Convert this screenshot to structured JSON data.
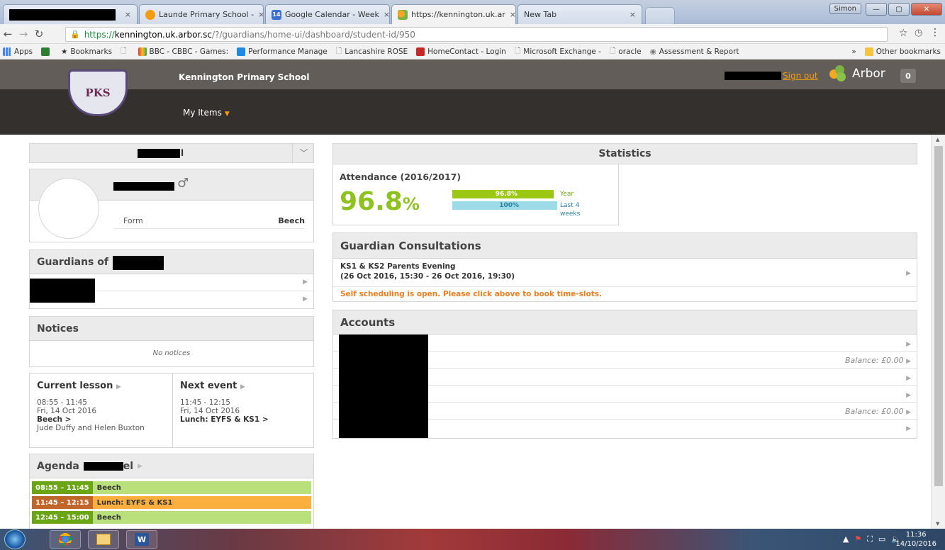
{
  "browser": {
    "tabs": [
      {
        "title": "",
        "redacted": true
      },
      {
        "title": "Launde Primary School -"
      },
      {
        "title": "Google Calendar - Week"
      },
      {
        "title": "https://kennington.uk.ar"
      },
      {
        "title": "New Tab"
      }
    ],
    "calendar_icon_text": "14",
    "user_button": "Simon",
    "url_protocol": "https://",
    "url_host": "kennington.uk.arbor.sc",
    "url_path": "/?/guardians/home-ui/dashboard/student-id/950",
    "bookmarks": [
      "Apps",
      "Bookmarks",
      "BBC - CBBC - Games:",
      "Performance Manage",
      "Lancashire ROSE",
      "HomeContact - Login",
      "Microsoft Exchange -",
      "oracle",
      "Assessment & Report"
    ],
    "other_bookmarks": "Other bookmarks",
    "overflow": "»"
  },
  "header": {
    "school_name": "Kennington Primary School",
    "crest_text": "PKS",
    "sign_out": "Sign out",
    "brand": "Arbor",
    "notification_count": "0",
    "menu_label": "My Items"
  },
  "student": {
    "name_suffix": "l",
    "gender_symbol": "♂",
    "form_label": "Form",
    "form_value": "Beech"
  },
  "guardians": {
    "title": "Guardians of"
  },
  "notices": {
    "title": "Notices",
    "empty": "No notices"
  },
  "current_lesson": {
    "title": "Current lesson",
    "time": "08:55 - 11:45",
    "date": "Fri, 14 Oct 2016",
    "room": "Beech >",
    "teachers": "Jude Duffy and Helen Buxton"
  },
  "next_event": {
    "title": "Next event",
    "time": "11:45 - 12:15",
    "date": "Fri, 14 Oct 2016",
    "name": "Lunch: EYFS & KS1 >"
  },
  "agenda": {
    "title": "Agenda",
    "name_suffix": "el",
    "items": [
      {
        "time": "08:55 – 11:45",
        "label": "Beech",
        "color": "#6aa513",
        "bg": "#b9e07a"
      },
      {
        "time": "11:45 – 12:15",
        "label": "Lunch: EYFS & KS1",
        "color": "#c0662a",
        "bg": "#fbaf3f"
      },
      {
        "time": "12:45 – 15:00",
        "label": "Beech",
        "color": "#6aa513",
        "bg": "#b9e07a"
      }
    ]
  },
  "statistics": {
    "title": "Statistics",
    "attendance_title": "Attendance (2016/2017)",
    "attendance_value": "96.8",
    "attendance_unit": "%",
    "bars": [
      {
        "value": 96.8,
        "label": "96.8%",
        "caption": "Year",
        "color": "#9cc713"
      },
      {
        "value": 100,
        "label": "100%",
        "caption": "Last 4 weeks",
        "color": "#9edbe8"
      }
    ]
  },
  "consultations": {
    "title": "Guardian Consultations",
    "event_name": "KS1 & KS2 Parents Evening",
    "event_time": "(26 Oct 2016, 15:30 - 26 Oct 2016, 19:30)",
    "note": "Self scheduling is open. Please click above to book time-slots."
  },
  "accounts": {
    "title": "Accounts",
    "rows": [
      "",
      "Balance: £0.00",
      "",
      "",
      "Balance: £0.00",
      ""
    ]
  },
  "taskbar": {
    "time": "11:36",
    "date": "14/10/2016"
  }
}
